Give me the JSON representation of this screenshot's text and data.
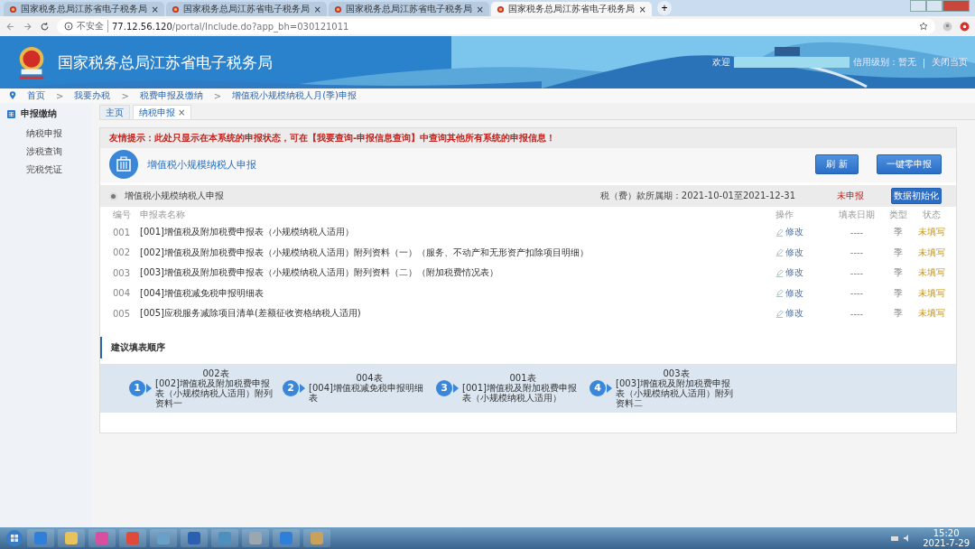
{
  "browser": {
    "tabs": [
      {
        "title": "国家税务总局江苏省电子税务局",
        "selected": false
      },
      {
        "title": "国家税务总局江苏省电子税务局",
        "selected": false
      },
      {
        "title": "国家税务总局江苏省电子税务局",
        "selected": false
      },
      {
        "title": "国家税务总局江苏省电子税务局",
        "selected": true
      }
    ],
    "new_tab": "+",
    "close_mark": "×",
    "security": "不安全",
    "url_host": "77.12.56.120",
    "url_path": "/portal/Include.do?app_bh=030121011"
  },
  "header": {
    "site_title": "国家税务总局江苏省电子税务局",
    "welcome": "欢迎",
    "credit": "信用级别：暂无",
    "separator": "|",
    "close_page": "关闭当页"
  },
  "breadcrumb": {
    "separator": ">",
    "items": [
      "首页",
      "我要办税",
      "税费申报及缴纳",
      "增值税小规模纳税人月(季)申报"
    ]
  },
  "sidebar": {
    "section": "申报缴纳",
    "items": [
      "纳税申报",
      "涉税查询",
      "完税凭证"
    ]
  },
  "page_tabs": [
    {
      "label": "主页",
      "selected": false,
      "closable": false
    },
    {
      "label": "纳税申报",
      "selected": true,
      "closable": true
    }
  ],
  "notice": "友情提示：此处只显示在本系统的申报状态，可在【我要查询-申报信息查询】中查询其他所有系统的申报信息！",
  "form": {
    "title": "增值税小规模纳税人申报",
    "buttons": [
      "刷 新",
      "一键零申报"
    ],
    "group": {
      "selected": true,
      "label": "增值税小规模纳税人申报",
      "period": "税（费）款所属期：2021-10-01至2021-12-31",
      "status": "未申报",
      "init_button": "数据初始化"
    },
    "columns": [
      "编号",
      "申报表名称",
      "操作",
      "填表日期",
      "类型",
      "状态"
    ],
    "rows": [
      {
        "no": "001",
        "name": "[001]增值税及附加税费申报表（小规模纳税人适用）",
        "action": "修改",
        "date": "----",
        "type": "季",
        "status": "未填写"
      },
      {
        "no": "002",
        "name": "[002]增值税及附加税费申报表（小规模纳税人适用）附列资料（一）（服务、不动产和无形资产扣除项目明细）",
        "action": "修改",
        "date": "----",
        "type": "季",
        "status": "未填写"
      },
      {
        "no": "003",
        "name": "[003]增值税及附加税费申报表（小规模纳税人适用）附列资料（二）（附加税费情况表）",
        "action": "修改",
        "date": "----",
        "type": "季",
        "status": "未填写"
      },
      {
        "no": "004",
        "name": "[004]增值税减免税申报明细表",
        "action": "修改",
        "date": "----",
        "type": "季",
        "status": "未填写"
      },
      {
        "no": "005",
        "name": "[005]应税服务减除项目清单(差额征收资格纳税人适用)",
        "action": "修改",
        "date": "----",
        "type": "季",
        "status": "未填写"
      }
    ]
  },
  "order": {
    "title": "建议填表顺序",
    "steps": [
      {
        "num": "1",
        "code": "002表",
        "desc": "[002]增值税及附加税费申报表（小规模纳税人适用）附列资料一"
      },
      {
        "num": "2",
        "code": "004表",
        "desc": "[004]增值税减免税申报明细表"
      },
      {
        "num": "3",
        "code": "001表",
        "desc": "[001]增值税及附加税费申报表（小规模纳税人适用）"
      },
      {
        "num": "4",
        "code": "003表",
        "desc": "[003]增值税及附加税费申报表（小规模纳税人适用）附列资料二"
      }
    ]
  },
  "taskbar": {
    "time": "15:20",
    "date": "2021-7-29"
  }
}
